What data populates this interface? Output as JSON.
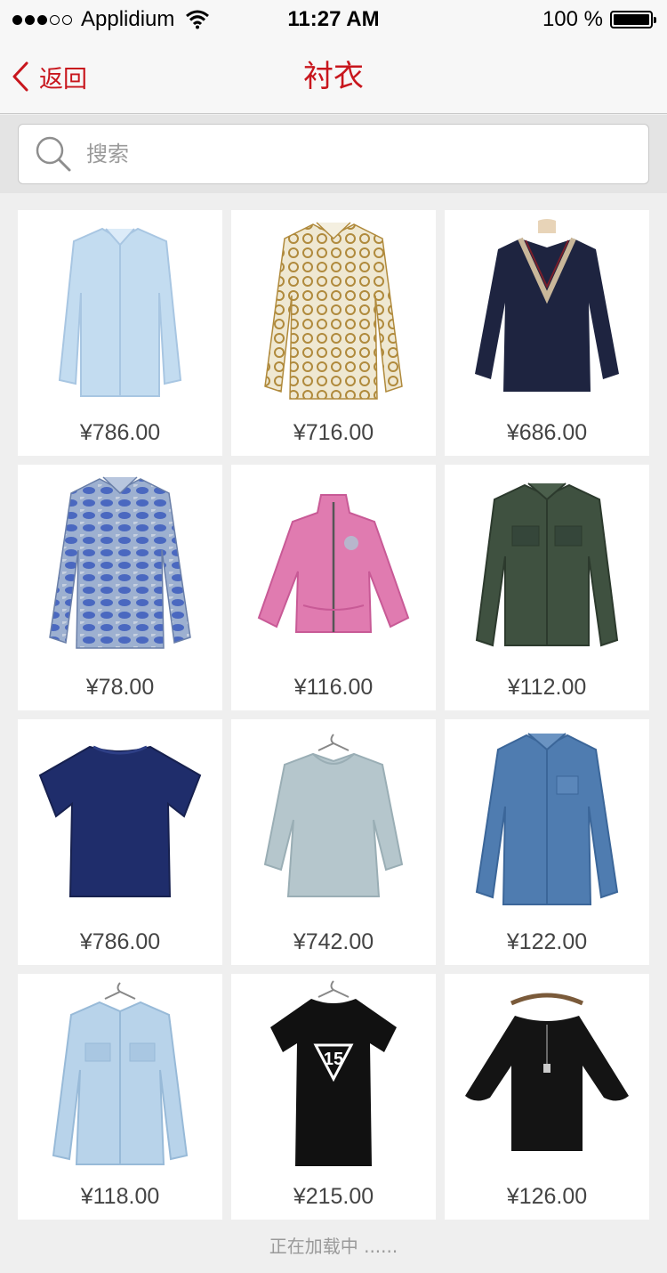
{
  "status_bar": {
    "carrier": "Applidium",
    "time": "11:27 AM",
    "battery": "100 %"
  },
  "nav": {
    "back_label": "返回",
    "title": "衬衣"
  },
  "search": {
    "placeholder": "搜索",
    "value": ""
  },
  "products": [
    {
      "price": "¥786.00",
      "item": "light-blue-dress-shirt",
      "colors": {
        "main": "#c3dcf0",
        "accent": "#a8c6e2"
      }
    },
    {
      "price": "¥716.00",
      "item": "chain-print-blouse",
      "colors": {
        "main": "#efe8d2",
        "accent": "#b08a3c"
      }
    },
    {
      "price": "¥686.00",
      "item": "navy-v-neck-sweater",
      "colors": {
        "main": "#1e2440",
        "accent": "#c9b79a"
      }
    },
    {
      "price": "¥78.00",
      "item": "snakeskin-print-shirt",
      "colors": {
        "main": "#8aa0c8",
        "accent": "#3a58b8"
      }
    },
    {
      "price": "¥116.00",
      "item": "pink-zip-jacket",
      "colors": {
        "main": "#e07bb0",
        "accent": "#c85a96"
      }
    },
    {
      "price": "¥112.00",
      "item": "green-suede-shirt",
      "colors": {
        "main": "#3f5140",
        "accent": "#2c3a2d"
      }
    },
    {
      "price": "¥786.00",
      "item": "navy-short-sleeve-top",
      "colors": {
        "main": "#1f2d6b",
        "accent": "#17214f"
      }
    },
    {
      "price": "¥742.00",
      "item": "sage-linen-blouse",
      "colors": {
        "main": "#b5c6cc",
        "accent": "#9aaeb5"
      }
    },
    {
      "price": "¥122.00",
      "item": "denim-shirt",
      "colors": {
        "main": "#4f7cb0",
        "accent": "#3b6699"
      }
    },
    {
      "price": "¥118.00",
      "item": "light-denim-shirt",
      "colors": {
        "main": "#b8d3ea",
        "accent": "#98bad8"
      }
    },
    {
      "price": "¥215.00",
      "item": "black-15-tee",
      "colors": {
        "main": "#111111",
        "accent": "#ffffff"
      }
    },
    {
      "price": "¥126.00",
      "item": "black-batwing-dress",
      "colors": {
        "main": "#141414",
        "accent": "#7a5a3a"
      }
    }
  ],
  "loading_text": "正在加载中 ......",
  "theme": {
    "accent": "#c8161d",
    "background": "#efefef"
  }
}
